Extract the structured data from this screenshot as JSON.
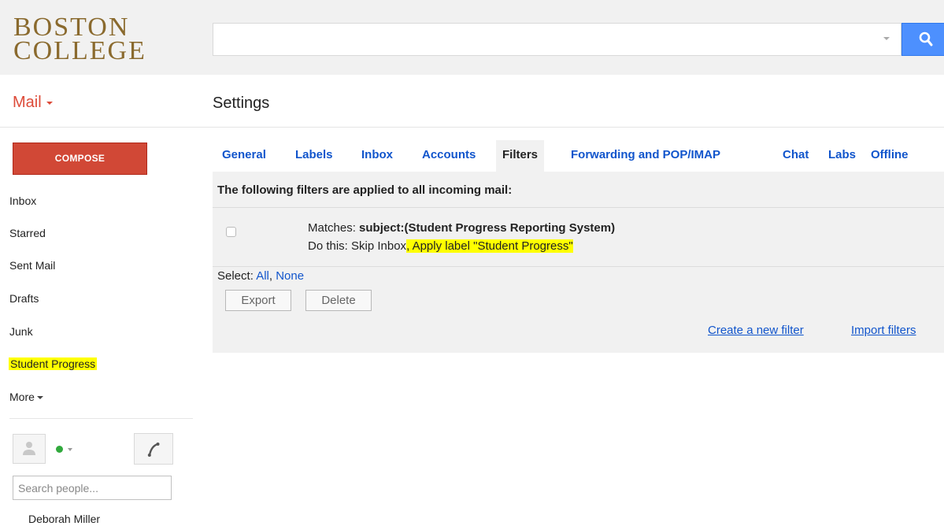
{
  "header": {
    "logo_line1": "BOSTON",
    "logo_line2": "COLLEGE",
    "search_value": ""
  },
  "app_menu": {
    "label": "Mail"
  },
  "page": {
    "title": "Settings"
  },
  "sidebar": {
    "compose_label": "COMPOSE",
    "items": [
      {
        "label": "Inbox"
      },
      {
        "label": "Starred"
      },
      {
        "label": "Sent Mail"
      },
      {
        "label": "Drafts"
      },
      {
        "label": "Junk"
      },
      {
        "label": "Student Progress",
        "highlighted": true
      }
    ],
    "more_label": "More",
    "status_color": "#31a93d",
    "people_search_placeholder": "Search people...",
    "contacts": [
      {
        "name": "Deborah Miller"
      }
    ]
  },
  "tabs": [
    {
      "label": "General"
    },
    {
      "label": "Labels"
    },
    {
      "label": "Inbox"
    },
    {
      "label": "Accounts"
    },
    {
      "label": "Filters",
      "active": true
    },
    {
      "label": "Forwarding and POP/IMAP"
    },
    {
      "label": "Chat"
    },
    {
      "label": "Labs"
    },
    {
      "label": "Offline"
    }
  ],
  "filters": {
    "heading": "The following filters are applied to all incoming mail:",
    "rows": [
      {
        "matches_prefix": "Matches: ",
        "matches_criteria": "subject:(Student Progress Reporting System)",
        "do_prefix": "Do this: Skip Inbox",
        "do_highlight": ", Apply label \"Student Progress\"",
        "checked": false
      }
    ],
    "select_label": "Select: ",
    "select_all": "All",
    "select_sep": ", ",
    "select_none": "None",
    "export_label": "Export",
    "delete_label": "Delete",
    "create_link": "Create a new filter",
    "import_link": "Import filters"
  },
  "colors": {
    "accent_red": "#dd4b39",
    "compose_bg": "#d14836",
    "search_blue": "#4d90fe",
    "link_blue": "#1155cc",
    "highlight": "#ffff00",
    "logo_gold": "#8a6a2e"
  }
}
